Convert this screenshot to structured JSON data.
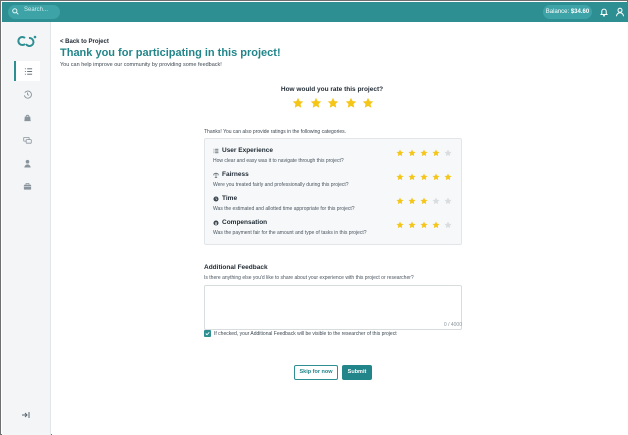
{
  "topbar": {
    "search_placeholder": "Search...",
    "balance_label": "Balance:",
    "balance_value": "$34.60",
    "bell_icon": "bell-icon",
    "user_icon": "user-icon"
  },
  "sidebar": {
    "logo": "logo-icon",
    "items": [
      {
        "icon": "list-icon",
        "active": true
      },
      {
        "icon": "history-icon",
        "active": false
      },
      {
        "icon": "bag-icon",
        "active": false
      },
      {
        "icon": "chat-icon",
        "active": false
      },
      {
        "icon": "person-icon",
        "active": false
      },
      {
        "icon": "box-icon",
        "active": false
      }
    ],
    "collapse_icon": "collapse-icon"
  },
  "header": {
    "back_label": "Back to Project",
    "title": "Thank you for participating in this project!",
    "subtitle": "You can help improve our community by providing some feedback!"
  },
  "rating": {
    "question": "How would you rate this project?",
    "value": 5,
    "max": 5
  },
  "categories": {
    "intro": "Thanks! You can also provide ratings in the following categories.",
    "items": [
      {
        "name": "User Experience",
        "description": "How clear and easy was it to navigate through this project?",
        "icon": "list-icon",
        "rating": 4
      },
      {
        "name": "Fairness",
        "description": "Were you treated fairly and professionally during this project?",
        "icon": "scale-icon",
        "rating": 5
      },
      {
        "name": "Time",
        "description": "Was the estimated and allotted time appropriate for this project?",
        "icon": "clock-icon",
        "rating": 3
      },
      {
        "name": "Compensation",
        "description": "Was the payment fair for the amount and type of tasks in this project?",
        "icon": "dollar-icon",
        "rating": 4
      }
    ]
  },
  "feedback": {
    "title": "Additional Feedback",
    "prompt": "Is there anything else you'd like to share about your experience with this project or researcher?",
    "value": "",
    "counter": "0 / 4000",
    "visibility_checked": true,
    "visibility_label": "If checked, your Additional Feedback will be visible to the researcher of this project"
  },
  "actions": {
    "skip_label": "Skip for now",
    "submit_label": "Submit"
  },
  "colors": {
    "accent": "#2e8f93",
    "title": "#21858a",
    "star_filled": "#f5c518",
    "star_empty": "#d9dde0"
  }
}
